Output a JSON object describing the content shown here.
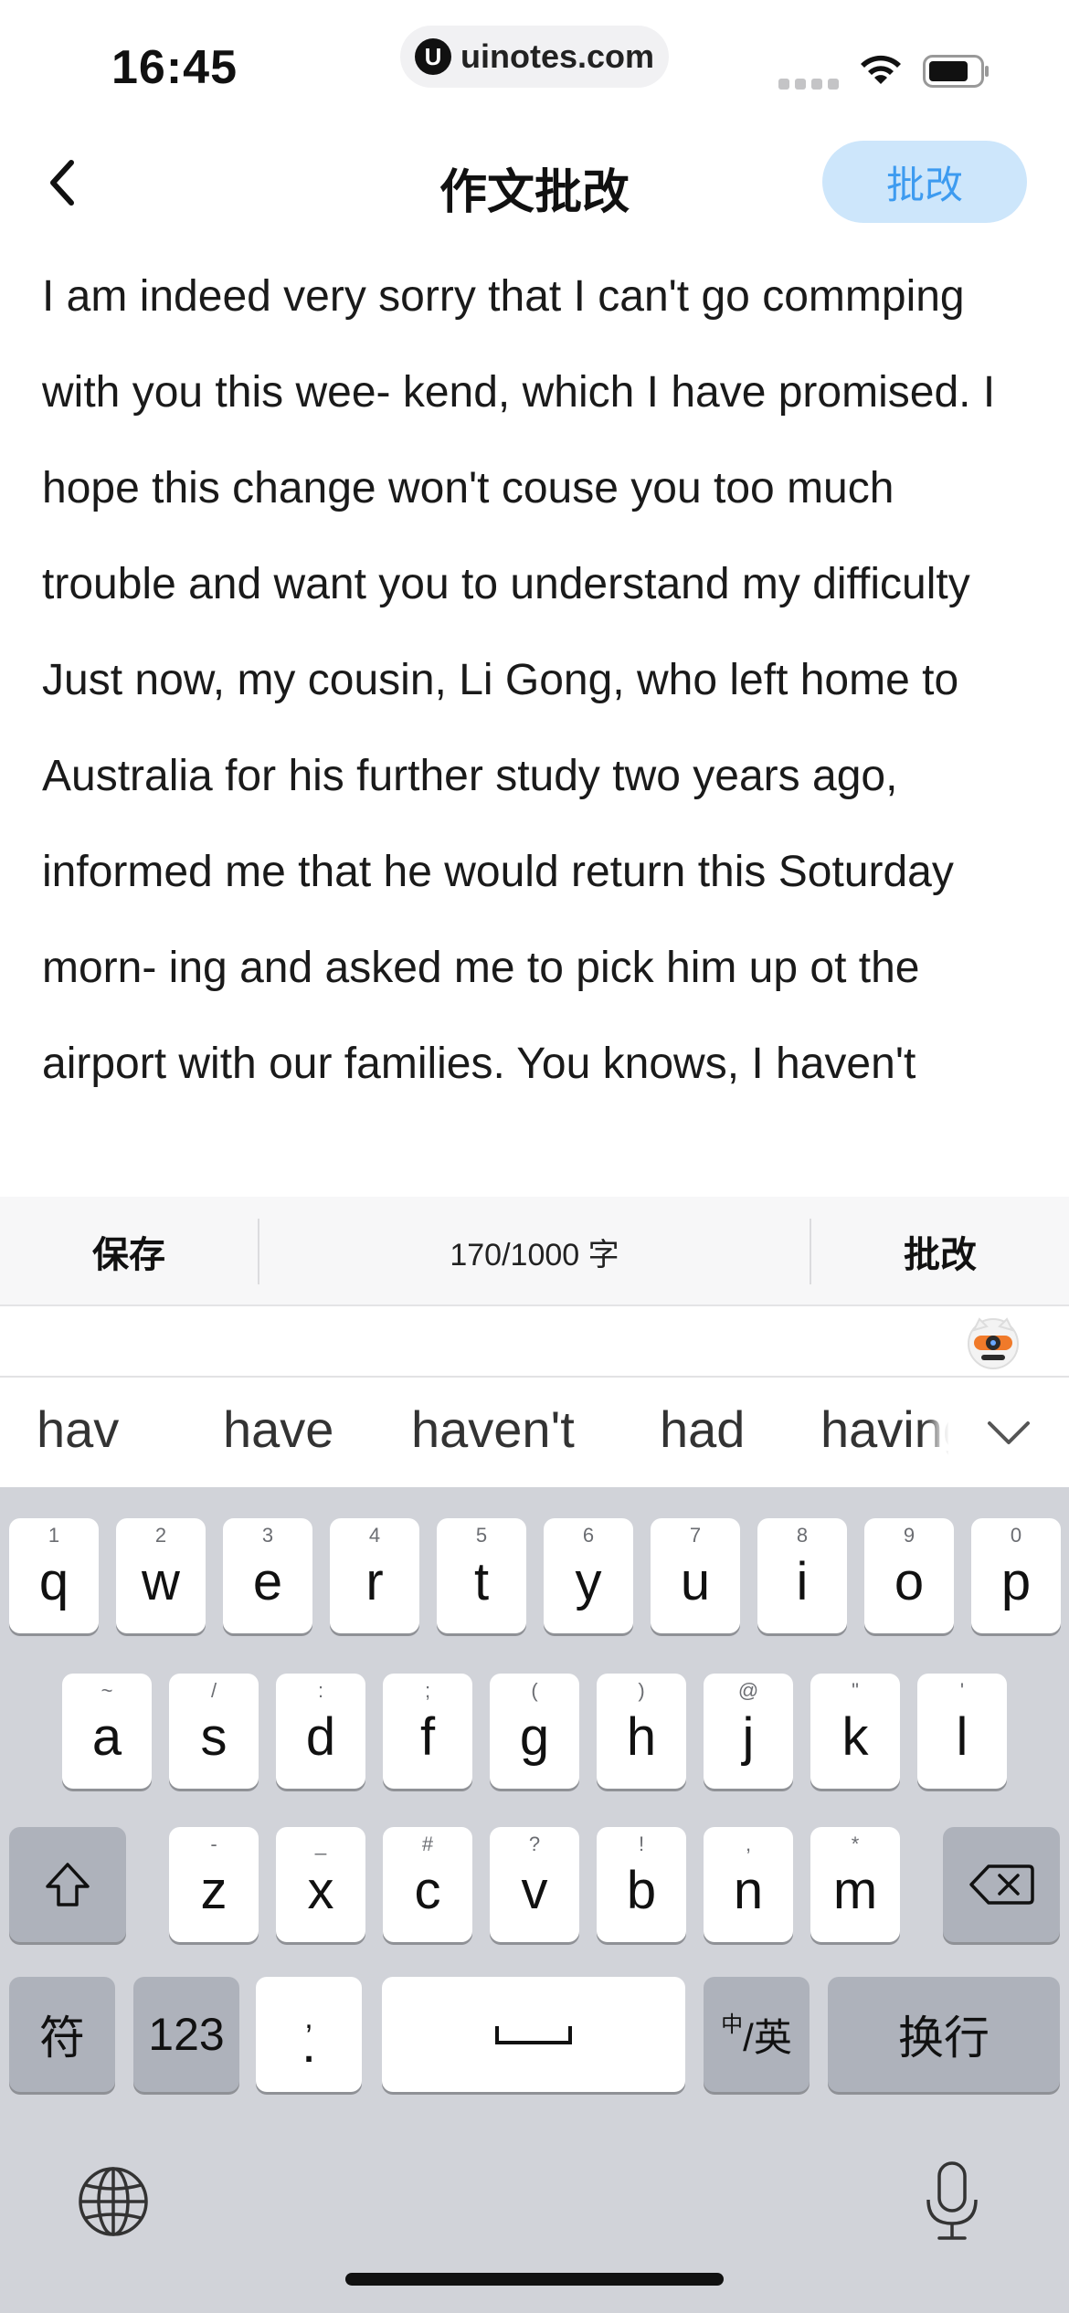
{
  "status_bar": {
    "time": "16:45",
    "url": "uinotes.com",
    "url_logo": "U",
    "icons": [
      "cellular-signal-icon",
      "wifi-icon",
      "battery-icon"
    ]
  },
  "nav": {
    "title": "作文批改",
    "correct_button": "批改",
    "back_icon": "chevron-left-icon"
  },
  "essay": {
    "text": "I am indeed very sorry that I can't go commping with you this wee- kend, which I have promised. I hope this change won't couse you too much trouble and want you to understand my difficulty\nJust now, my cousin, Li Gong, who left home to Australia for his further study two years ago, informed me that he would return this Soturday morn- ing and asked me to pick him up ot the airport with our families. You knows, I haven't"
  },
  "toolbar": {
    "save": "保存",
    "word_count": "170/1000 字",
    "correct": "批改"
  },
  "suggestions": {
    "items": [
      "hav",
      "have",
      "haven't",
      "had",
      "having"
    ],
    "collapse_icon": "chevron-down-icon"
  },
  "keyboard": {
    "row1": [
      {
        "main": "q",
        "sub": "1"
      },
      {
        "main": "w",
        "sub": "2"
      },
      {
        "main": "e",
        "sub": "3"
      },
      {
        "main": "r",
        "sub": "4"
      },
      {
        "main": "t",
        "sub": "5"
      },
      {
        "main": "y",
        "sub": "6"
      },
      {
        "main": "u",
        "sub": "7"
      },
      {
        "main": "i",
        "sub": "8"
      },
      {
        "main": "o",
        "sub": "9"
      },
      {
        "main": "p",
        "sub": "0"
      }
    ],
    "row2": [
      {
        "main": "a",
        "sub": "~"
      },
      {
        "main": "s",
        "sub": "/"
      },
      {
        "main": "d",
        "sub": ":"
      },
      {
        "main": "f",
        "sub": ";"
      },
      {
        "main": "g",
        "sub": "("
      },
      {
        "main": "h",
        "sub": ")"
      },
      {
        "main": "j",
        "sub": "@"
      },
      {
        "main": "k",
        "sub": "\""
      },
      {
        "main": "l",
        "sub": "'"
      }
    ],
    "row3": [
      {
        "main": "z",
        "sub": "-"
      },
      {
        "main": "x",
        "sub": "_"
      },
      {
        "main": "c",
        "sub": "#"
      },
      {
        "main": "v",
        "sub": "?"
      },
      {
        "main": "b",
        "sub": "!"
      },
      {
        "main": "n",
        "sub": ","
      },
      {
        "main": "m",
        "sub": "*"
      }
    ],
    "symbols_key": "符",
    "numbers_key": "123",
    "punct_key_main": ".",
    "punct_key_sub": ",",
    "lang_key_small": "中",
    "lang_key_main": "/英",
    "return_key": "换行",
    "bottom_icons": [
      "globe-icon",
      "microphone-icon"
    ]
  }
}
